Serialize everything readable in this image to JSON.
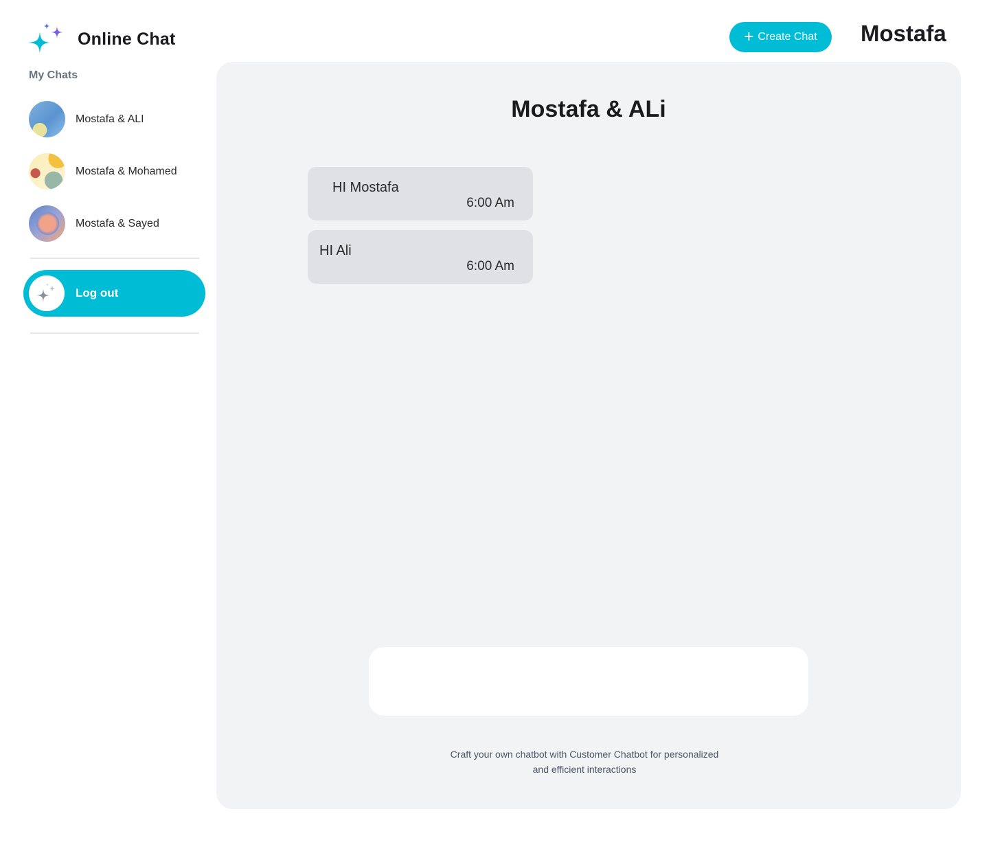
{
  "app": {
    "title": "Online Chat"
  },
  "sidebar": {
    "section_label": "My Chats",
    "chats": [
      {
        "name": "Mostafa & ALI",
        "avatar": "blue-abstract-avatar"
      },
      {
        "name": "Mostafa & Mohamed",
        "avatar": "yellow-spheres-avatar"
      },
      {
        "name": "Mostafa & Sayed",
        "avatar": "gradient-orb-avatar"
      }
    ],
    "logout_label": "Log out"
  },
  "header": {
    "create_chat_label": "Create Chat",
    "username": "Mostafa"
  },
  "chat": {
    "title": "Mostafa & ALi",
    "messages": [
      {
        "text": "HI Mostafa",
        "time": "6:00 Am"
      },
      {
        "text": "HI Ali",
        "time": "6:00 Am"
      }
    ],
    "input": {
      "value": "",
      "placeholder": ""
    },
    "footer_line1": "Craft your own chatbot with Customer Chatbot for personalized",
    "footer_line2": "and efficient interactions"
  },
  "colors": {
    "accent": "#00bcd4",
    "panel_bg": "#f2f3f5",
    "bubble_bg": "#dfe1e5",
    "sparkle_purple": "#7b5ce6"
  }
}
